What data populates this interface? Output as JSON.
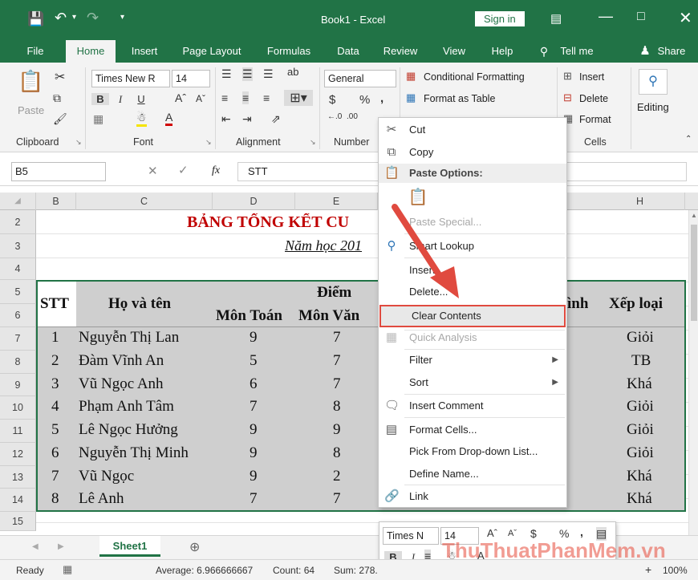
{
  "window": {
    "title": "Book1  -  Excel",
    "signin": "Sign in"
  },
  "tabs": [
    "File",
    "Home",
    "Insert",
    "Page Layout",
    "Formulas",
    "Data",
    "Review",
    "View",
    "Help",
    "Tell me",
    "Share"
  ],
  "ribbon": {
    "paste": "Paste",
    "font_name": "Times New R",
    "font_size": "14",
    "number_format": "General",
    "conditional": "Conditional Formatting",
    "format_table": "Format as Table",
    "insert": "Insert",
    "delete": "Delete",
    "format": "Format",
    "editing": "Editing",
    "groups": [
      "Clipboard",
      "Font",
      "Alignment",
      "Number",
      "Cells"
    ],
    "bold": "B",
    "italic": "I",
    "underline": "U",
    "currency": "$",
    "percent": "%",
    "comma": ","
  },
  "formula": {
    "namebox": "B5",
    "value": "STT",
    "fx": "fx"
  },
  "columns": [
    "B",
    "C",
    "D",
    "E",
    "H"
  ],
  "rows": [
    "2",
    "3",
    "4",
    "5",
    "6",
    "7",
    "8",
    "9",
    "10",
    "11",
    "12",
    "13",
    "14",
    "15"
  ],
  "sheet": {
    "title": "BẢNG TỔNG KẾT CU",
    "subtitle": "Năm học 201",
    "h_stt": "STT",
    "h_name": "Họ và tên",
    "h_score": "Điểm",
    "h_math": "Môn Toán",
    "h_lit": "Môn Văn",
    "h_avg_tail": "ình",
    "h_rank": "Xếp loại",
    "records": [
      {
        "stt": "1",
        "name": "Nguyễn Thị Lan",
        "math": "9",
        "lit": "7",
        "rank": "Giỏi"
      },
      {
        "stt": "2",
        "name": "Đàm Vĩnh An",
        "math": "5",
        "lit": "7",
        "rank": "TB"
      },
      {
        "stt": "3",
        "name": "Vũ Ngọc Anh",
        "math": "6",
        "lit": "7",
        "rank": "Khá"
      },
      {
        "stt": "4",
        "name": "Phạm Anh Tâm",
        "math": "7",
        "lit": "8",
        "rank": "Giỏi"
      },
      {
        "stt": "5",
        "name": "Lê Ngọc Hưởng",
        "math": "9",
        "lit": "9",
        "rank": "Giỏi"
      },
      {
        "stt": "6",
        "name": "Nguyễn Thị Minh",
        "math": "9",
        "lit": "8",
        "rank": "Giỏi"
      },
      {
        "stt": "7",
        "name": "Vũ Ngọc",
        "math": "9",
        "lit": "2",
        "rank": "Khá"
      },
      {
        "stt": "8",
        "name": "Lê Anh",
        "math": "7",
        "lit": "7",
        "rank": "Khá"
      }
    ]
  },
  "context_menu": {
    "items": [
      "Cut",
      "Copy",
      "Paste Options:",
      "Paste Special...",
      "Smart Lookup",
      "Insert...",
      "Delete...",
      "Clear Contents",
      "Quick Analysis",
      "Filter",
      "Sort",
      "Insert Comment",
      "Format Cells...",
      "Pick From Drop-down List...",
      "Define Name...",
      "Link"
    ],
    "highlight_color": "#e04a3f"
  },
  "mini_toolbar": {
    "font": "Times N",
    "size": "14",
    "bold": "B",
    "italic": "I"
  },
  "sheet_tab": "Sheet1",
  "status": {
    "ready": "Ready",
    "average": "Average: 6.966666667",
    "count": "Count: 64",
    "sum": "Sum: 278.",
    "zoom": "100%"
  },
  "watermark": "ThuThuatPhanMem.vn",
  "colors": {
    "excel_green": "#217346",
    "selection_gray": "#cfcfcf",
    "title_red": "#c00000"
  }
}
